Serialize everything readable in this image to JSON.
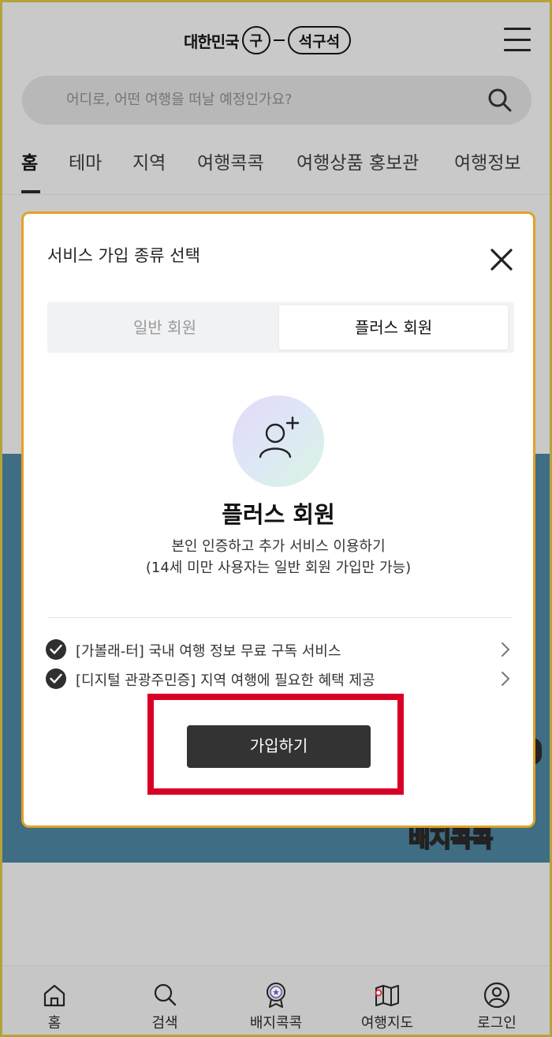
{
  "header": {
    "logo_prefix": "대한민국",
    "logo_circle": "구",
    "logo_pill": "석구석",
    "search_placeholder": "어디로, 어떤 여행을 떠날 예정인가요?"
  },
  "nav": {
    "tabs": [
      "홈",
      "테마",
      "지역",
      "여행콕콕",
      "여행상품 홍보관",
      "여행정보"
    ],
    "active": "홈"
  },
  "banner": {
    "badge_text": "배지콕콕"
  },
  "modal": {
    "title": "서비스 가입 종류 선택",
    "tabs": [
      "일반 회원",
      "플러스 회원"
    ],
    "selected_tab": "플러스 회원",
    "plus_title": "플러스 회원",
    "plus_desc_line1": "본인 인증하고 추가 서비스 이용하기",
    "plus_desc_line2": "(14세 미만 사용자는 일반 회원 가입만 가능)",
    "benefits": [
      "[가볼래-터] 국내 여행 정보 무료 구독 서비스",
      "[디지털 관광주민증] 지역 여행에 필요한 혜택 제공"
    ],
    "join_button": "가입하기"
  },
  "bottom_nav": {
    "items": [
      "홈",
      "검색",
      "배지콕콕",
      "여행지도",
      "로그인"
    ]
  },
  "colors": {
    "modal_border": "#e1a128",
    "highlight": "#d80026",
    "button_bg": "#333333"
  }
}
